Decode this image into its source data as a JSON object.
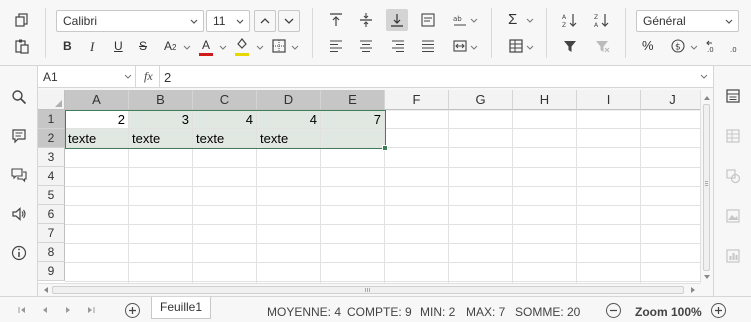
{
  "toolbar": {
    "font_name": "Calibri",
    "font_size": "11",
    "number_format": "Général",
    "bold_label": "B",
    "italic_label": "I",
    "underline_label": "U",
    "strike_label": "S",
    "subscript_label": "A",
    "text_color_label": "A",
    "text_color": "#d01a1a",
    "fill_color": "#e6d800",
    "percent_label": "%",
    "sum_label": "Σ"
  },
  "formula_bar": {
    "cell_ref": "A1",
    "fx_label": "fx",
    "value": "2"
  },
  "sheet": {
    "columns": [
      "A",
      "B",
      "C",
      "D",
      "E",
      "F",
      "G",
      "H",
      "I",
      "J"
    ],
    "rows": [
      "1",
      "2",
      "3",
      "4",
      "5",
      "6",
      "7",
      "8",
      "9"
    ],
    "row1": [
      "2",
      "3",
      "4",
      "4",
      "7"
    ],
    "row2": [
      "texte",
      "texte",
      "texte",
      "texte",
      ""
    ]
  },
  "statusbar": {
    "tab_name": "Feuille1",
    "average": "MOYENNE: 4",
    "count": "COMPTE: 9",
    "min": "MIN: 2",
    "max": "MAX: 7",
    "sum": "SOMME: 20",
    "zoom": "Zoom 100%"
  },
  "colors": {
    "accent_green": "#3f7f5a",
    "selection_fill": "#e1e8e1",
    "header_selected": "#c6c6c6"
  }
}
